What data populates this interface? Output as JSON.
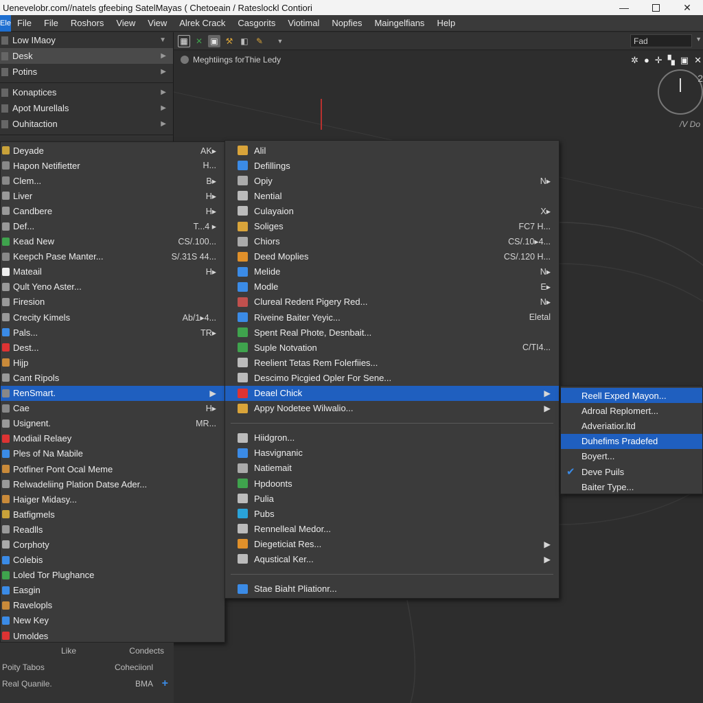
{
  "window": {
    "title": "Uenevelobr.com//natels gfeebing SatelMayas ( Chetoeain / Rateslockl Contiori",
    "minimize": "—",
    "close": "✕"
  },
  "menubar": {
    "app_icon": "Ele",
    "items": [
      "File",
      "File",
      "Roshors",
      "View",
      "View",
      "Alrek Crack",
      "Casgorits",
      "Viotimal",
      "Nopfies",
      "Maingelfians",
      "Help"
    ]
  },
  "toolbar": {
    "search_value": "Fad"
  },
  "canvas": {
    "breadcrumb": "Meghtiings forThie Ledy",
    "vp_label": "/V Do",
    "gauge_number": "2"
  },
  "left_panel": {
    "items_top": [
      {
        "label": "Low IMaoy",
        "arrow": "▼"
      },
      {
        "label": "Desk",
        "arrow": "▶",
        "selected": true
      },
      {
        "label": "Potins",
        "arrow": "▶"
      }
    ],
    "items_mid": [
      {
        "label": "Konaptices",
        "arrow": "▶"
      },
      {
        "label": "Apot Murellals",
        "arrow": "▶"
      },
      {
        "label": "Ouhitaction",
        "arrow": "▶"
      }
    ]
  },
  "menu1": {
    "items": [
      {
        "label": "Deyade",
        "shortcut": "AK▸",
        "color": "#c9a23a"
      },
      {
        "label": "Hapon Netifietter",
        "shortcut": "H...",
        "color": "#888"
      },
      {
        "label": "Clem...",
        "shortcut": "B▸",
        "color": "#888"
      },
      {
        "label": "Liver",
        "shortcut": "H▸",
        "color": "#999"
      },
      {
        "label": "Candbere",
        "shortcut": "H▸",
        "color": "#999"
      },
      {
        "label": "Def...",
        "shortcut": "T...4 ▸",
        "color": "#999"
      },
      {
        "label": "Kead New",
        "shortcut": "CS/.100...",
        "color": "#3fa34d"
      },
      {
        "label": "Keepch Pase Manter...",
        "shortcut": "S/.31S 44...",
        "color": "#888"
      },
      {
        "label": "Mateail",
        "shortcut": "H▸",
        "color": "#eee"
      },
      {
        "label": "Qult Yeno Aster...",
        "shortcut": "",
        "color": "#999"
      },
      {
        "label": "Firesion",
        "shortcut": "",
        "color": "#999"
      },
      {
        "label": "Crecity Kimels",
        "shortcut": "Ab/1▸4...",
        "color": "#999"
      },
      {
        "label": "Pals...",
        "shortcut": "TR▸",
        "color": "#3b8be6"
      },
      {
        "label": "Dest...",
        "shortcut": "",
        "color": "#d33"
      },
      {
        "label": "Hijp",
        "shortcut": "",
        "color": "#c98a3a"
      },
      {
        "label": "Cant Ripols",
        "shortcut": "",
        "color": "#999"
      },
      {
        "label": "RenSmart.",
        "shortcut": "▶",
        "color": "#888",
        "highlight": true
      },
      {
        "label": "Cae",
        "shortcut": "H▸",
        "color": "#888"
      },
      {
        "label": "Usignent.",
        "shortcut": "MR...",
        "color": "#999"
      },
      {
        "label": "Modiail Relaey",
        "shortcut": "",
        "color": "#d33"
      },
      {
        "label": "Ples of Na Mabile",
        "shortcut": "",
        "color": "#3b8be6"
      },
      {
        "label": "Potfiner Pont Ocal Meme",
        "shortcut": "",
        "color": "#c98a3a"
      },
      {
        "label": "Relwadeliing Plation Datse Ader...",
        "shortcut": "",
        "color": "#999"
      },
      {
        "label": "Haiger Midasy...",
        "shortcut": "",
        "color": "#c98a3a"
      },
      {
        "label": "Batfigmels",
        "shortcut": "",
        "color": "#c9a23a"
      },
      {
        "label": "Readlls",
        "shortcut": "",
        "color": "#999"
      },
      {
        "label": "Corphoty",
        "shortcut": "",
        "color": "#aaa"
      },
      {
        "label": "Colebis",
        "shortcut": "",
        "color": "#3b8be6"
      },
      {
        "label": "Loled Tor Plughance",
        "shortcut": "",
        "color": "#3fa34d"
      },
      {
        "label": "Easgin",
        "shortcut": "",
        "color": "#3b8be6"
      },
      {
        "label": "Ravelopls",
        "shortcut": "",
        "color": "#c98a3a"
      },
      {
        "label": "New Key",
        "shortcut": "",
        "color": "#3b8be6"
      },
      {
        "label": "Umoldes",
        "shortcut": "",
        "color": "#d33"
      }
    ]
  },
  "menu2": {
    "group1": [
      {
        "label": "Alil",
        "shortcut": "",
        "color": "#d9a43a"
      },
      {
        "label": "Defillings",
        "shortcut": "",
        "color": "#3b8be6"
      },
      {
        "label": "Opiy",
        "shortcut": "N▸",
        "color": "#aaa"
      },
      {
        "label": "Nential",
        "shortcut": "",
        "color": "#bbb"
      },
      {
        "label": "Culayaion",
        "shortcut": "X▸",
        "color": "#bbb"
      },
      {
        "label": "Soliges",
        "shortcut": "FC7 H...",
        "color": "#d9a43a"
      },
      {
        "label": "Chiors",
        "shortcut": "CS/.10▸4...",
        "color": "#aaa"
      },
      {
        "label": "Deed Moplies",
        "shortcut": "CS/.120 H...",
        "color": "#e0902a"
      },
      {
        "label": "Melide",
        "shortcut": "N▸",
        "color": "#3b8be6"
      },
      {
        "label": "Modle",
        "shortcut": "E▸",
        "color": "#3b8be6"
      },
      {
        "label": "Clureal Redent Pigery Red...",
        "shortcut": "N▸",
        "color": "#c0504d"
      },
      {
        "label": "Riveine Baiter Yeyic...",
        "shortcut": "Eletal",
        "color": "#3b8be6"
      },
      {
        "label": "Spent Real Phote, Desnbait...",
        "shortcut": "",
        "color": "#3fa34d"
      },
      {
        "label": "Suple Notvation",
        "shortcut": "C/TI4...",
        "color": "#3fa34d"
      },
      {
        "label": "Reelient Tetas Rem Folerfiies...",
        "shortcut": "",
        "color": "#bbb"
      },
      {
        "label": "Descimo Picgied Opler For Sene...",
        "shortcut": "",
        "color": "#bbb"
      },
      {
        "label": "Deael Chick",
        "shortcut": "▶",
        "color": "#d33",
        "highlight": true
      },
      {
        "label": "Appy Nodetee Wilwalio...",
        "shortcut": "▶",
        "color": "#d9a43a"
      }
    ],
    "group2": [
      {
        "label": "Hiidgron...",
        "shortcut": "",
        "color": "#bbb"
      },
      {
        "label": "Hasvignanic",
        "shortcut": "",
        "color": "#3b8be6"
      },
      {
        "label": "Natiemait",
        "shortcut": "",
        "color": "#aaa"
      },
      {
        "label": "Hpdoonts",
        "shortcut": "",
        "color": "#3fa34d"
      },
      {
        "label": "Pulia",
        "shortcut": "",
        "color": "#bbb"
      },
      {
        "label": "Pubs",
        "shortcut": "",
        "color": "#2aa3d9"
      },
      {
        "label": "Rennelleal Medor...",
        "shortcut": "",
        "color": "#bbb"
      },
      {
        "label": "Diegeticiat Res...",
        "shortcut": "▶",
        "color": "#e0902a"
      },
      {
        "label": "Aqustical Ker...",
        "shortcut": "▶",
        "color": "#bbb"
      }
    ],
    "footer": {
      "label": "Stae Biaht Pliationr...",
      "color": "#3b8be6"
    }
  },
  "menu3": {
    "items": [
      {
        "label": "Reell Exped Mayon...",
        "highlight": true,
        "checked": false
      },
      {
        "label": "Adroal Replomert...",
        "highlight": false,
        "checked": false
      },
      {
        "label": "Adveriatior.ltd",
        "highlight": false,
        "checked": false
      },
      {
        "label": "Duhefims Pradefed",
        "highlight": true,
        "checked": false
      },
      {
        "label": "Boyert...",
        "highlight": false,
        "checked": false
      },
      {
        "label": "Deve Puils",
        "highlight": false,
        "checked": true
      },
      {
        "label": "Baiter Type...",
        "highlight": false,
        "checked": false
      }
    ]
  },
  "bottom": {
    "row1_left": "Like",
    "row1_right": "Condects",
    "row2_left": "Poity Tabos",
    "row2_right": "Coheciionl",
    "row3_left": "Real Quanile.",
    "row3_right": "BMA"
  }
}
